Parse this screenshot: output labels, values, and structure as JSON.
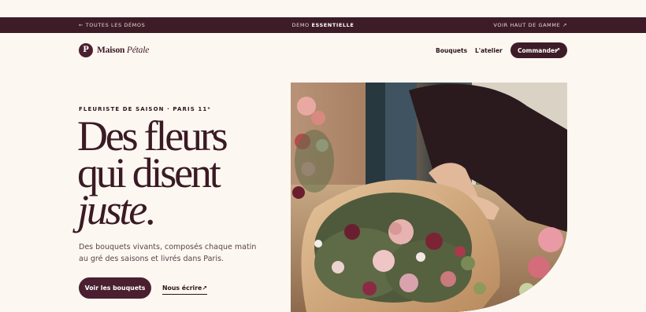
{
  "topbar": {
    "back_label": "← TOUTES LES DÉMOS",
    "demo_prefix": "DEMO",
    "demo_name": "ESSENTIELLE",
    "premium_label": "VOIR HAUT DE GAMME ↗"
  },
  "brand": {
    "mark": "P",
    "name_bold": "Maison",
    "name_italic": "Pétale"
  },
  "nav": {
    "items": [
      {
        "label": "Bouquets"
      },
      {
        "label": "L'atelier"
      }
    ],
    "cta_label": "Commander",
    "cta_arrow": "↗"
  },
  "hero": {
    "eyebrow": "FLEURISTE DE SAISON · PARIS 11ᵉ",
    "headline_line1": "Des fleurs",
    "headline_line2": "qui disent",
    "headline_em": "juste",
    "headline_end": ".",
    "subtitle": "Des bouquets vivants, composés chaque matin au gré des saisons et livrés dans Paris.",
    "primary_button": "Voir les bouquets",
    "secondary_link": "Nous écrire",
    "secondary_arrow": "↗"
  },
  "colors": {
    "background": "#fdf7f2",
    "brand_dark": "#3d1c27",
    "text": "#3a1a24"
  }
}
